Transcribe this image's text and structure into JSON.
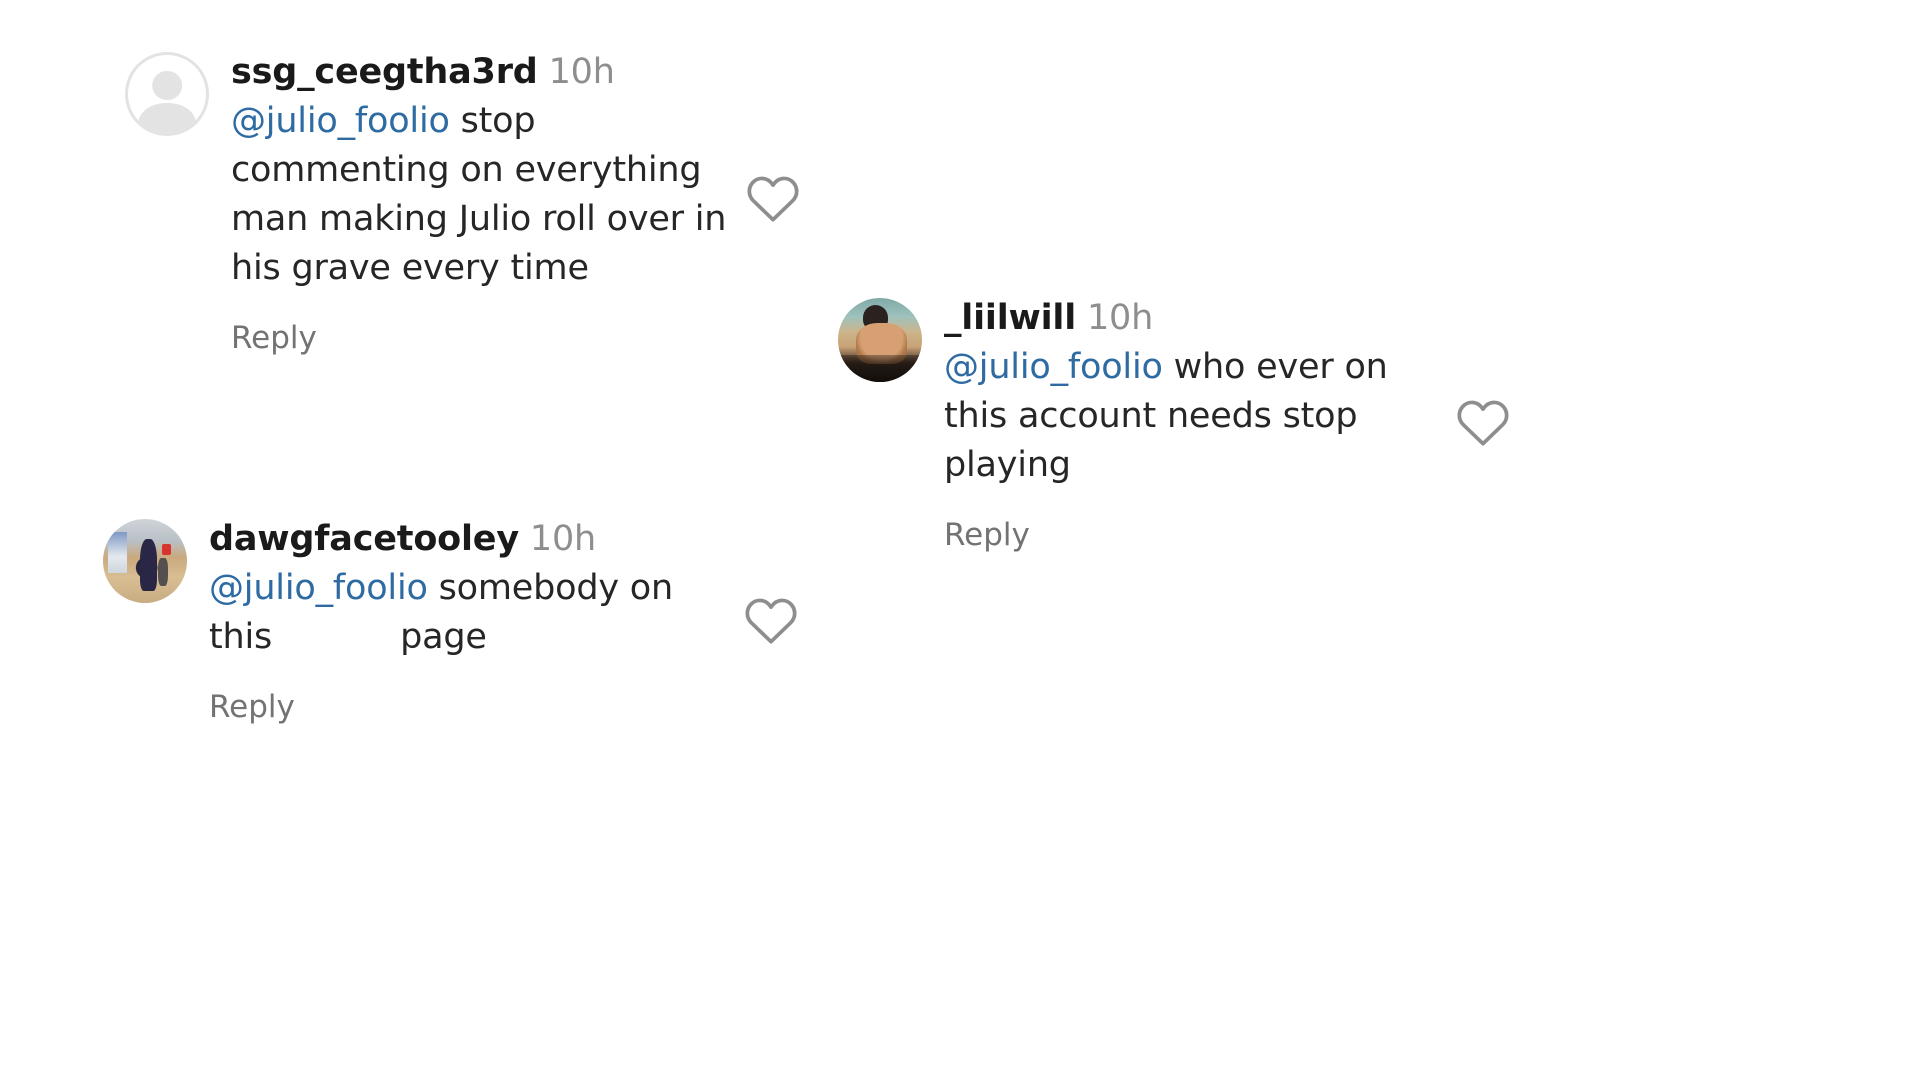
{
  "app": {
    "name": "instagram-comments",
    "background": "#ffffff",
    "text_color": "#262626",
    "muted_color": "#8e8e8e",
    "mention_color": "#2f6ba3",
    "reply_color": "#737373",
    "heart_stroke": "#8e8e8e"
  },
  "comments": [
    {
      "id": "comment-ssg-ceegtha3rd",
      "username": "ssg_ceegtha3rd",
      "timestamp": "10h",
      "avatar_type": "default-avatar",
      "mention": "@julio_foolio",
      "lines": [
        "stop",
        "commenting on everything",
        "man making Julio roll over in",
        "his grave every time"
      ],
      "reply_label": "Reply",
      "like_icon": "heart-icon"
    },
    {
      "id": "comment-dawgfacetooley",
      "username": "dawgfacetooley",
      "timestamp": "10h",
      "avatar_type": "photo-avatar",
      "mention": "@julio_foolio",
      "lines": [
        "somebody on",
        "this",
        "page"
      ],
      "reply_label": "Reply",
      "like_icon": "heart-icon"
    },
    {
      "id": "comment-liilwill",
      "username": "_liilwill",
      "timestamp": "10h",
      "avatar_type": "photo-avatar",
      "mention": "@julio_foolio",
      "lines": [
        "who ever on",
        "this account needs stop",
        "playing"
      ],
      "reply_label": "Reply",
      "like_icon": "heart-icon"
    }
  ]
}
